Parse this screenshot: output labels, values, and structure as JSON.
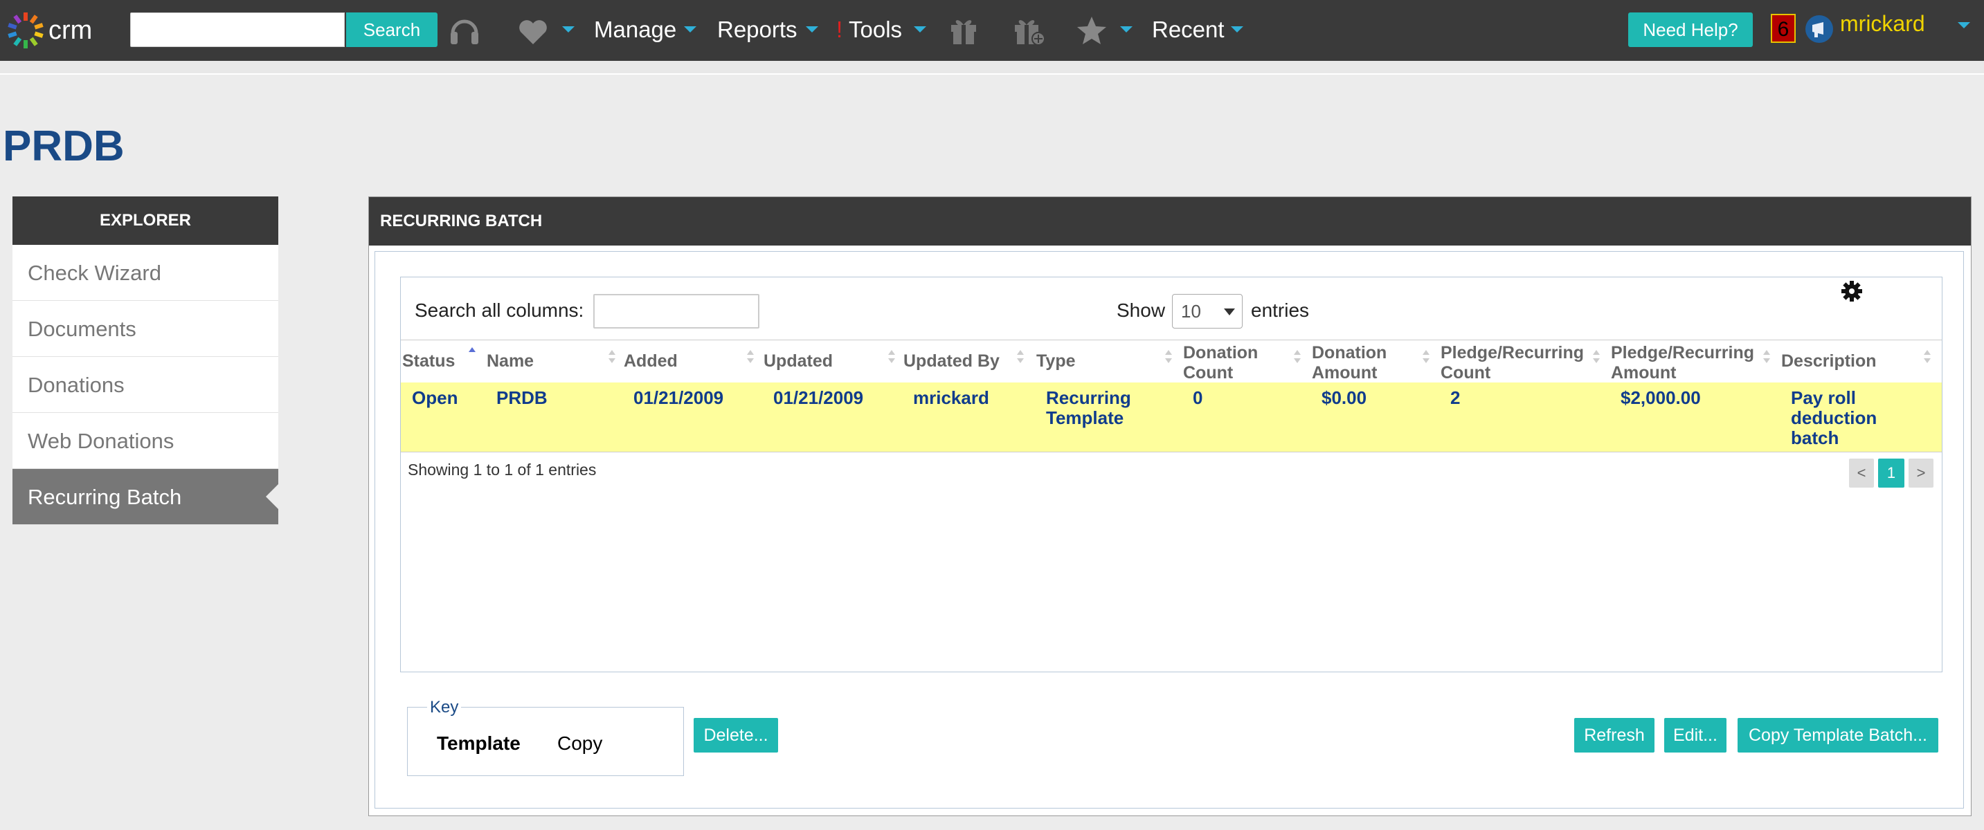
{
  "app": {
    "logo_text": "crm",
    "logo_icon": "pinwheel-logo-icon"
  },
  "header": {
    "search_placeholder": "",
    "search_button": "Search",
    "nav": {
      "manage": "Manage",
      "reports": "Reports",
      "tools_alert": "!",
      "tools": "Tools",
      "recent": "Recent"
    },
    "help_button": "Need Help?",
    "notification_count": "6",
    "username": "mrickard"
  },
  "page": {
    "title": "PRDB"
  },
  "explorer": {
    "header": "EXPLORER",
    "items": [
      "Check Wizard",
      "Documents",
      "Donations",
      "Web Donations",
      "Recurring Batch"
    ],
    "active_index": 4
  },
  "panel": {
    "header": "RECURRING BATCH",
    "search_label": "Search all columns:",
    "search_value": "",
    "show_label": "Show",
    "show_value": "10",
    "entries_label": "entries",
    "columns": [
      "Status",
      "Name",
      "Added",
      "Updated",
      "Updated By",
      "Type",
      "Donation Count",
      "Donation Amount",
      "Pledge/Recurring Count",
      "Pledge/Recurring Amount",
      "Description"
    ],
    "sorted_column": "Status",
    "rows": [
      {
        "status": "Open",
        "name": "PRDB",
        "added": "01/21/2009",
        "updated": "01/21/2009",
        "updated_by": "mrickard",
        "type": "Recurring Template",
        "donation_count": "0",
        "donation_amount": "$0.00",
        "pledge_count": "2",
        "pledge_amount": "$2,000.00",
        "description": "Pay roll deduction batch"
      }
    ],
    "info": "Showing 1 to 1 of 1 entries",
    "pager": {
      "prev": "<",
      "current": "1",
      "next": ">"
    }
  },
  "key": {
    "legend": "Key",
    "template": "Template",
    "copy": "Copy"
  },
  "actions": {
    "delete": "Delete...",
    "refresh": "Refresh",
    "edit": "Edit...",
    "copy_template": "Copy Template Batch..."
  },
  "colors": {
    "accent": "#1fb8b2",
    "topbar": "#3a3a3a",
    "row_highlight": "#fefe9c",
    "title": "#1a4a86",
    "username": "#f0d400"
  }
}
